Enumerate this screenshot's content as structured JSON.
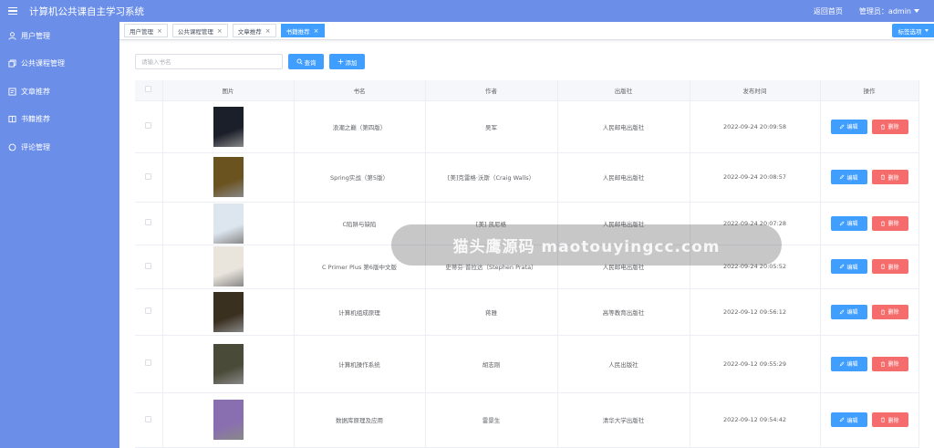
{
  "header": {
    "title": "计算机公共课自主学习系统",
    "home_link": "返回首页",
    "admin_label": "管理员：admin"
  },
  "sidebar": {
    "items": [
      {
        "label": "用户管理",
        "icon": "user-icon"
      },
      {
        "label": "公共课程管理",
        "icon": "copy-icon"
      },
      {
        "label": "文章推荐",
        "icon": "document-icon"
      },
      {
        "label": "书籍推荐",
        "icon": "book-icon"
      },
      {
        "label": "评论管理",
        "icon": "comment-icon"
      }
    ]
  },
  "tabs": [
    {
      "label": "用户管理",
      "active": false
    },
    {
      "label": "公共课程管理",
      "active": false
    },
    {
      "label": "文章推荐",
      "active": false
    },
    {
      "label": "书籍推荐",
      "active": true
    }
  ],
  "tab_options_label": "标签选项",
  "close_glyph": "×",
  "toolbar": {
    "search_placeholder": "请输入书名",
    "query_label": "查询",
    "add_label": "添加"
  },
  "table": {
    "headers": [
      "图片",
      "书名",
      "作者",
      "出版社",
      "发布时间",
      "操作"
    ],
    "edit_label": "编辑",
    "delete_label": "删除",
    "rows": [
      {
        "title": "浪潮之巅（第四版）",
        "author": "吴军",
        "publisher": "人民邮电出版社",
        "time": "2022-09-24 20:09:58",
        "cover": "#1b1f2a"
      },
      {
        "title": "Spring实战（第5版）",
        "author": "[美]克雷格·沃斯（Craig Walls）",
        "publisher": "人民邮电出版社",
        "time": "2022-09-24 20:08:57",
        "cover": "#6b5320"
      },
      {
        "title": "C陷阱与缺陷",
        "author": "[美] 凯尼格",
        "publisher": "人民邮电出版社",
        "time": "2022-09-24 20:07:28",
        "cover": "#dde6ef"
      },
      {
        "title": "C Primer Plus 第6版中文版",
        "author": "史蒂芬·普拉达（Stephen Prata）",
        "publisher": "人民邮电出版社",
        "time": "2022-09-24 20:05:52",
        "cover": "#e9e4dc"
      },
      {
        "title": "计算机组成原理",
        "author": "蒋雅",
        "publisher": "高等教育出版社",
        "time": "2022-09-12 09:56:12",
        "cover": "#3a3020"
      },
      {
        "title": "计算机操作系统",
        "author": "胡志刚",
        "publisher": "人民出版社",
        "time": "2022-09-12 09:55:29",
        "cover": "#4a4a38"
      },
      {
        "title": "数据库原理及应用",
        "author": "雷景生",
        "publisher": "清华大学出版社",
        "time": "2022-09-12 09:54:42",
        "cover": "#8a6fb0"
      }
    ]
  },
  "watermark": "猫头鹰源码 maotouyingcc.com"
}
